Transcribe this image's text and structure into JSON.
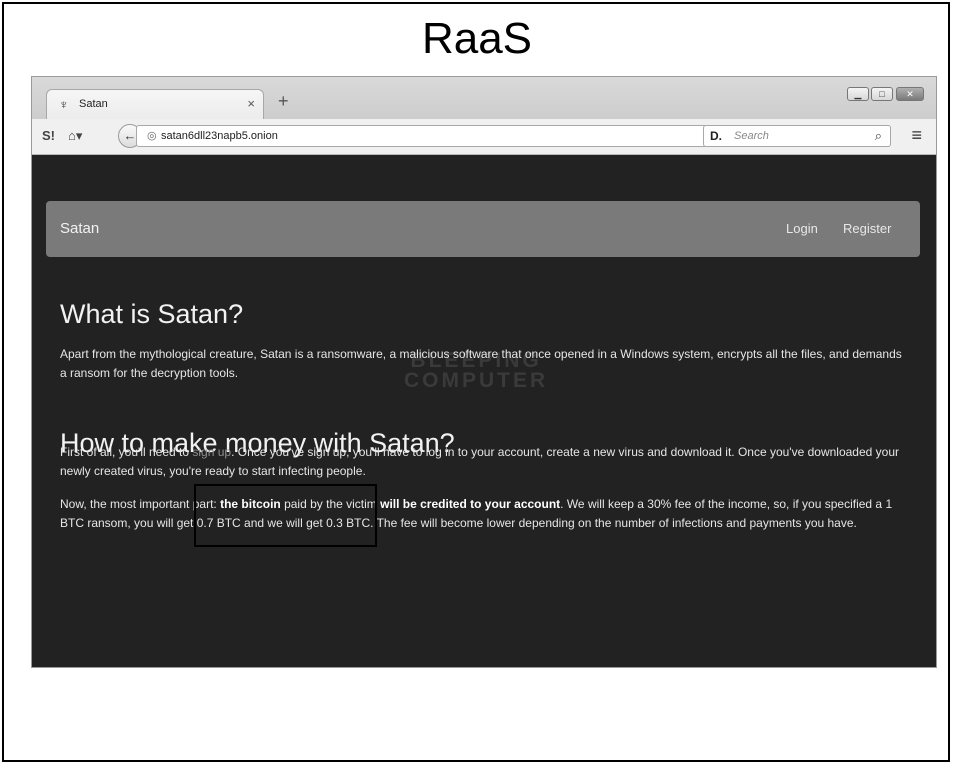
{
  "slide": {
    "title": "RaaS"
  },
  "browser": {
    "tab_title": "Satan",
    "tab_close": "×",
    "new_tab": "+",
    "url": "satan6dll23napb5.onion",
    "search_logo": "D.",
    "search_placeholder": "Search",
    "window_controls": [
      "minimize",
      "maximize",
      "close"
    ]
  },
  "site": {
    "brand": "Satan",
    "nav": {
      "login": "Login",
      "register": "Register"
    },
    "watermark_line1": "BLEEPING",
    "watermark_line2": "COMPUTER",
    "section1": {
      "heading": "What is Satan?",
      "body": "Apart from the mythological creature, Satan is a ransomware, a malicious software that once opened in a Windows system, encrypts all the files, and demands a ransom for the decryption tools."
    },
    "section2": {
      "heading": "How to make money with Satan?",
      "p1_start": "First of all, you'll need to ",
      "p1_link": "sign up",
      "p1_end": ". Once you've sign up, you'll have to log in to your account, create a new virus and download it. Once you've downloaded your newly created virus, you're ready to start infecting people.",
      "p2_a": "Now, the most important part: ",
      "p2_b_bold": "the bitcoin",
      "p2_c": " paid by the victim ",
      "p2_d_bold": "will be credited to your account",
      "p2_e": ". We will keep a 30% fee of the income, so, if you specified a 1 BTC ransom, you will get 0.7 BTC and we will get 0.3 BTC. The fee will become lower depending on the number of infections and payments you have."
    }
  },
  "colors": {
    "page_bg": "#222222",
    "site_nav_bg": "#7a7a7a",
    "link": "#8f8f8f"
  }
}
